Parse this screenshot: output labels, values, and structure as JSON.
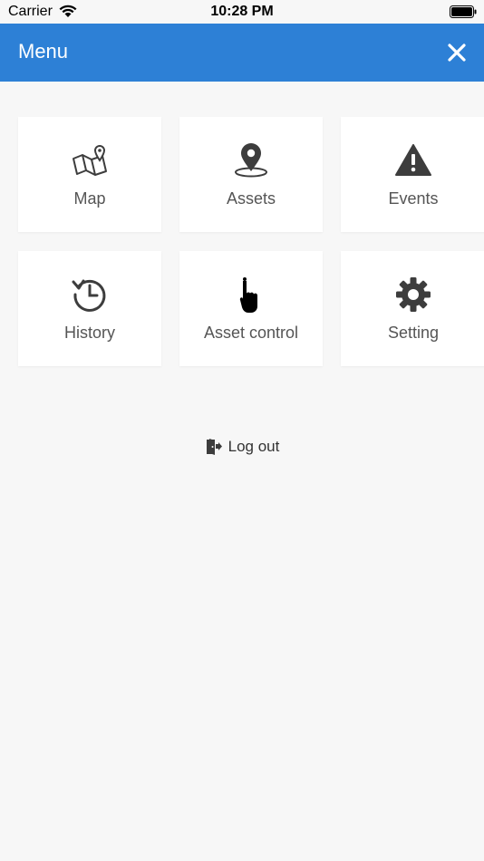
{
  "status_bar": {
    "carrier": "Carrier",
    "time": "10:28 PM"
  },
  "header": {
    "title": "Menu",
    "close_icon": "close-icon"
  },
  "tiles": [
    {
      "label": "Map",
      "icon": "map-pin-icon"
    },
    {
      "label": "Assets",
      "icon": "location-marker-icon"
    },
    {
      "label": "Events",
      "icon": "warning-icon"
    },
    {
      "label": "History",
      "icon": "history-clock-icon"
    },
    {
      "label": "Asset control",
      "icon": "hand-pointer-icon"
    },
    {
      "label": "Setting",
      "icon": "gear-icon"
    }
  ],
  "logout": {
    "label": "Log out",
    "icon": "logout-door-icon"
  },
  "colors": {
    "accent": "#2d80d6",
    "icon": "#3d3d3d",
    "text": "#555555",
    "background": "#f7f7f7"
  }
}
